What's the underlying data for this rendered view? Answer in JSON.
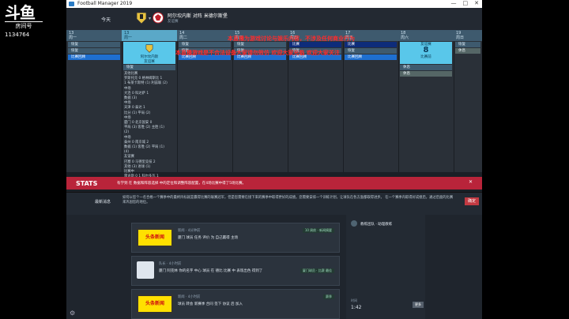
{
  "overlay": {
    "platform_logo": "斗鱼",
    "platform_sub": "房间号",
    "room_id": "1134764"
  },
  "window": {
    "title": "Football Manager 2019",
    "minimize": "—",
    "maximize": "□",
    "close": "✕"
  },
  "header": {
    "today": "今天",
    "match_title": "阿尔坎内斯 对阵 米德尔斯堡",
    "match_sub": "友谊赛"
  },
  "calendar": {
    "columns": [
      {
        "day": "13",
        "weekday": "周一",
        "events": [
          {
            "kind": "train",
            "text": "恢复"
          },
          {
            "kind": "train",
            "text": "恢复"
          },
          {
            "kind": "scout",
            "text": "比赛回顾"
          }
        ]
      },
      {
        "day": "14",
        "weekday": "周二",
        "events": [
          {
            "kind": "train",
            "text": "恢复"
          },
          {
            "kind": "train",
            "text": "恢复"
          },
          {
            "kind": "scout",
            "text": "比赛回顾"
          }
        ]
      },
      {
        "day": "15",
        "weekday": "周三",
        "events": [
          {
            "kind": "train",
            "text": "恢复"
          },
          {
            "kind": "train",
            "text": "恢复"
          },
          {
            "kind": "scout",
            "text": "比赛回顾"
          }
        ]
      },
      {
        "day": "16",
        "weekday": "周四",
        "events": [
          {
            "kind": "match",
            "text": "比赛"
          },
          {
            "kind": "train",
            "text": "恢复"
          },
          {
            "kind": "scout",
            "text": "比赛回顾"
          }
        ]
      },
      {
        "day": "17",
        "weekday": "周五",
        "events": [
          {
            "kind": "match",
            "text": "比赛"
          },
          {
            "kind": "train",
            "text": "恢复"
          },
          {
            "kind": "scout",
            "text": "比赛回顾"
          }
        ]
      },
      {
        "day": "18",
        "weekday": "周六",
        "events": [
          {
            "kind": "train",
            "text": "休息"
          },
          {
            "kind": "rest",
            "text": "休息"
          }
        ]
      },
      {
        "day": "19",
        "weekday": "周日",
        "events": [
          {
            "kind": "train",
            "text": "恢复"
          },
          {
            "kind": "rest",
            "text": "休息"
          }
        ]
      }
    ],
    "today_col": {
      "day": "13",
      "weekday": "周一",
      "tag": "周一",
      "box_label": "阿尔坎内斯",
      "box_sub": "友谊赛",
      "events": [
        {
          "kind": "train",
          "text": "恢复"
        }
      ],
      "details": "其他比赛\n罗斯托克 0 格林姆斯比 1\n 1 布莱卡斯特 (1) 利兹联 (2)\n 中场\n 大连 0 科达萨 1\n 数据 (3)\n 中场\n 天津 0 泰达 1\n 比分 (1) 平局 (2)\n 中场\n 厦门 0 北京国安 0\n 平局 (3) 客胜 (2) 主胜 (1)\n (2)\n 中场\n 泰州 0 南京城 2\n 数据 (1) 客胜 (2) 平局 (1)\n (4)\n 友谊赛\n 巴塞 0 马德里竞技 2\n 其他 (3) 进球 (1)\n 比赛中\n 雷迪斯 0 1 科尔多瓦 1"
    },
    "right_box": {
      "label": "友谊赛",
      "num": "8",
      "sub": "比赛前"
    }
  },
  "stream_overlay_text": {
    "line1": "本直播为游戏讨论与娱乐内容，不涉及任何商业行为",
    "line2": "本直播游戏是不合法设备大家请勿效仿 欢迎大家光临 欢迎大家关注"
  },
  "stats": {
    "label": "STATS",
    "text": "有学到 在 数据和阵容选择 中的定位和调整阵容配置，在4场比赛中得了5场比赛。",
    "close": "✕"
  },
  "advice": {
    "label": "最新消息",
    "text": "如何以您个一名合格一个赛季中的最终目标就是赢得比赛的联赛冠军，但是您需要在接下来的赛季中取得更好的成绩。您需要安排一个训练计划，让球队在各方面都取得进步。\n在一个赛季内取得好成绩后，通过后面的比赛来巩固您的地位。",
    "button": "确定"
  },
  "feed": {
    "items": [
      {
        "kind": "thumb",
        "thumb": "头条新闻",
        "meta": "新闻 · 4分钟前",
        "text": "厦门 球员 任务 评价 为 自己赢得 主场",
        "tag": "10 周前 · 新闻摘要"
      },
      {
        "kind": "avatar",
        "meta": "队长 · 4小时前",
        "text": "厦门 阿克林 你的名字 中心 球员 在 德比 比赛 中 表现出色 得到了",
        "tag": "厦门球员 · 比赛 最佳"
      },
      {
        "kind": "thumb",
        "thumb": "头条新闻",
        "meta": "新闻 · 4小时前",
        "text": "球员 转会 新赛季 合同 签下 协议 后 加入",
        "tag": "赛季"
      }
    ]
  },
  "right_panel": {
    "person": "教练团队 · 助理教练",
    "label": "时间",
    "time": "1:42",
    "button": "更多"
  },
  "colors": {
    "accent_cyan": "#59c7ea",
    "stats_red": "#b9243a",
    "header_blue": "#3e5a6e"
  }
}
